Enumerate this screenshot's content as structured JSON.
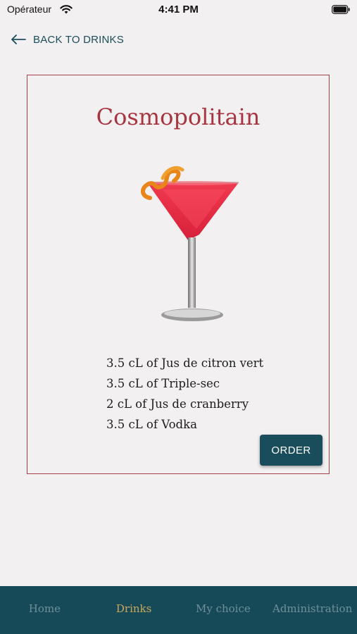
{
  "status_bar": {
    "carrier": "Opérateur",
    "time": "4:41 PM",
    "icons": [
      "wifi-icon",
      "battery-icon"
    ]
  },
  "back_link": {
    "label": "BACK TO DRINKS",
    "icon": "arrow-left-icon"
  },
  "drink": {
    "name": "Cosmopolitain",
    "image": "cosmopolitan-cocktail-glass",
    "ingredients": [
      "3.5 cL of Jus de citron vert",
      "3.5 cL of Triple-sec",
      "2 cL of Jus de cranberry",
      "3.5 cL of Vodka"
    ],
    "order_label": "ORDER"
  },
  "nav": {
    "items": [
      {
        "label": "Home",
        "active": false
      },
      {
        "label": "Drinks",
        "active": true
      },
      {
        "label": "My choice",
        "active": false
      },
      {
        "label": "Administration",
        "active": false
      }
    ]
  },
  "colors": {
    "background": "#f2f0f1",
    "accent": "#1a4d5c",
    "title": "#a8353f",
    "card_border": "#a8424a",
    "nav_active": "#c9a85c",
    "nav_inactive": "#6f8f98"
  }
}
